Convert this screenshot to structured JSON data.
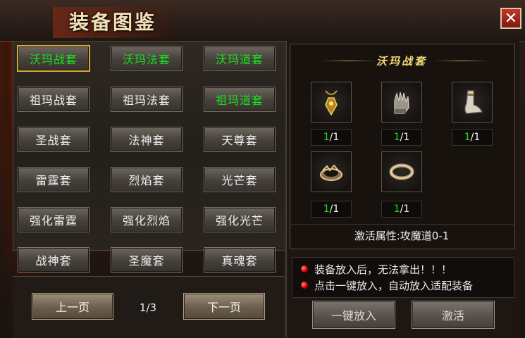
{
  "window": {
    "title": "装备图鉴",
    "close_symbol": "✕"
  },
  "set_buttons": [
    {
      "label": "沃玛战套",
      "green": true,
      "selected": true
    },
    {
      "label": "沃玛法套",
      "green": true,
      "selected": false
    },
    {
      "label": "沃玛道套",
      "green": true,
      "selected": false
    },
    {
      "label": "祖玛战套",
      "green": false,
      "selected": false
    },
    {
      "label": "祖玛法套",
      "green": false,
      "selected": false
    },
    {
      "label": "祖玛道套",
      "green": true,
      "selected": false
    },
    {
      "label": "圣战套",
      "green": false,
      "selected": false
    },
    {
      "label": "法神套",
      "green": false,
      "selected": false
    },
    {
      "label": "天尊套",
      "green": false,
      "selected": false
    },
    {
      "label": "雷霆套",
      "green": false,
      "selected": false
    },
    {
      "label": "烈焰套",
      "green": false,
      "selected": false
    },
    {
      "label": "光芒套",
      "green": false,
      "selected": false
    },
    {
      "label": "强化雷霆",
      "green": false,
      "selected": false
    },
    {
      "label": "强化烈焰",
      "green": false,
      "selected": false
    },
    {
      "label": "强化光芒",
      "green": false,
      "selected": false
    },
    {
      "label": "战神套",
      "green": false,
      "selected": false
    },
    {
      "label": "圣魔套",
      "green": false,
      "selected": false
    },
    {
      "label": "真魂套",
      "green": false,
      "selected": false
    }
  ],
  "pagination": {
    "prev_label": "上一页",
    "next_label": "下一页",
    "page_text": "1/3"
  },
  "detail": {
    "set_name": "沃玛战套",
    "items": [
      {
        "icon": "necklace-icon",
        "have": "1",
        "need": "/1"
      },
      {
        "icon": "glove-icon",
        "have": "1",
        "need": "/1"
      },
      {
        "icon": "boot-icon",
        "have": "1",
        "need": "/1"
      },
      {
        "icon": "bracelet-icon",
        "have": "1",
        "need": "/1"
      },
      {
        "icon": "ring-icon",
        "have": "1",
        "need": "/1"
      }
    ],
    "attribute_text": "激活属性:攻魔道0-1"
  },
  "notes": [
    "装备放入后，无法拿出！！！",
    "点击一键放入，自动放入适配装备"
  ],
  "actions": {
    "auto_place_label": "一键放入",
    "activate_label": "激活"
  },
  "colors": {
    "green_text": "#19e21e",
    "gold_title": "#f3d77a",
    "close_red": "#c23a2a"
  }
}
